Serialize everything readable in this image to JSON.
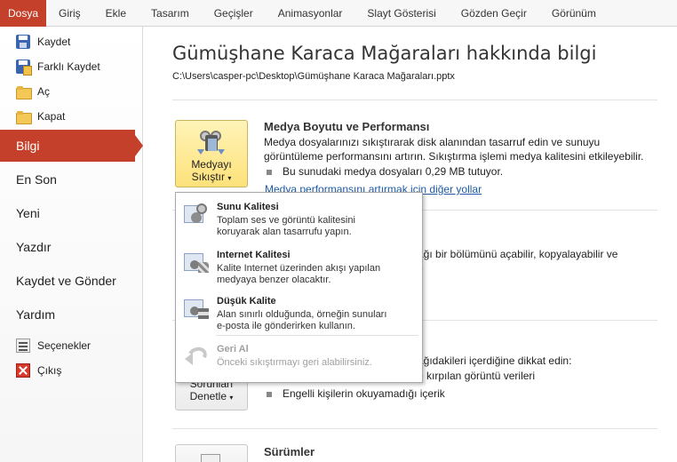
{
  "ribbon": {
    "tabs": [
      "Dosya",
      "Giriş",
      "Ekle",
      "Tasarım",
      "Geçişler",
      "Animasyonlar",
      "Slayt Gösterisi",
      "Gözden Geçir",
      "Görünüm"
    ]
  },
  "backstage": {
    "commands_top": [
      {
        "label": "Kaydet",
        "icon": "save-icon"
      },
      {
        "label": "Farklı Kaydet",
        "icon": "save-as-icon"
      },
      {
        "label": "Aç",
        "icon": "open-folder-icon"
      },
      {
        "label": "Kapat",
        "icon": "close-folder-icon"
      }
    ],
    "nav": [
      "Bilgi",
      "En Son",
      "Yeni",
      "Yazdır",
      "Kaydet ve Gönder",
      "Yardım"
    ],
    "active_nav": "Bilgi",
    "commands_bottom": [
      {
        "label": "Seçenekler",
        "icon": "options-icon"
      },
      {
        "label": "Çıkış",
        "icon": "exit-icon"
      }
    ],
    "accent_color": "#c4402a"
  },
  "info": {
    "title": "Gümüşhane Karaca Mağaraları hakkında bilgi",
    "path": "C:\\Users\\casper-pc\\Desktop\\Gümüşhane Karaca Mağaraları.pptx",
    "media": {
      "button_line1": "Medyayı",
      "button_line2": "Sıkıştır",
      "caret": "▾",
      "heading": "Medya Boyutu ve Performansı",
      "text_line1": "Medya dosyalarınızı sıkıştırarak disk alanından tasarruf edin ve sunuyu",
      "text_line2": "görüntüleme performansını artırın. Sıkıştırma işlemi medya kalitesini etkileyebilir.",
      "bullet": "Bu sunudaki medya dosyaları 0,29 MB tutuyor.",
      "link": "Medya performansını artırmak için diğer yollar"
    },
    "permissions_partial_line1": "ağı bir bölümünü açabilir, kopyalayabilir ve",
    "permissions_partial_line2": "e",
    "prepare": {
      "partial_intro": "ağıdakileri içerdiğine dikkat edin:",
      "partial_bullet1": "e kırpılan görüntü verileri",
      "bullet2": "Engelli kişilerin okuyamadığı içerik",
      "button_line1": "Sorunları",
      "button_line2": "Denetle",
      "caret": "▾"
    },
    "versions": {
      "heading": "Sürümler"
    }
  },
  "compress_menu": {
    "items": [
      {
        "title": "Sunu Kalitesi",
        "desc1": "Toplam ses ve görüntü kalitesini",
        "desc2": "koruyarak alan tasarrufu yapın.",
        "icon": "presentation-quality-icon",
        "enabled": true
      },
      {
        "title": "Internet Kalitesi",
        "desc1": "Kalite Internet üzerinden akışı yapılan",
        "desc2": "medyaya benzer olacaktır.",
        "icon": "internet-quality-icon",
        "enabled": true
      },
      {
        "title": "Düşük Kalite",
        "desc1": "Alan sınırlı olduğunda, örneğin sunuları",
        "desc2": "e-posta ile gönderirken kullanın.",
        "icon": "low-quality-icon",
        "enabled": true
      },
      {
        "title": "Geri Al",
        "desc1": "Önceki sıkıştırmayı geri alabilirsiniz.",
        "desc2": "",
        "icon": "undo-icon",
        "enabled": false
      }
    ]
  }
}
